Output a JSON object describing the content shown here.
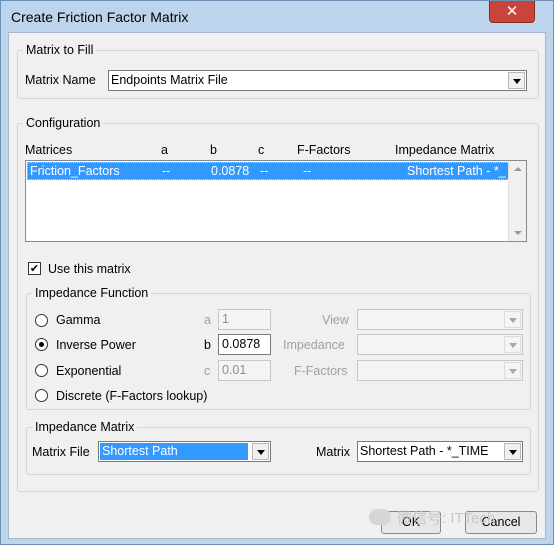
{
  "window": {
    "title": "Create Friction Factor Matrix",
    "close_glyph": "✕"
  },
  "matrix_to_fill": {
    "legend": "Matrix to Fill",
    "name_label": "Matrix Name",
    "name_value": "Endpoints Matrix File"
  },
  "configuration": {
    "legend": "Configuration",
    "columns": [
      "Matrices",
      "a",
      "b",
      "c",
      "F-Factors",
      "Impedance Matrix"
    ],
    "rows": [
      {
        "matrices": "Friction_Factors",
        "a": "--",
        "b": "0.0878",
        "c": "--",
        "f_factors": "--",
        "impedance_matrix": "Shortest Path - *_"
      }
    ],
    "use_matrix_label": "Use this matrix",
    "use_matrix_checked": true
  },
  "impedance_function": {
    "legend": "Impedance Function",
    "options": [
      "Gamma",
      "Inverse Power",
      "Exponential",
      "Discrete (F-Factors lookup)"
    ],
    "selected": "Inverse Power",
    "param_a_label": "a",
    "param_a_value": "1",
    "param_b_label": "b",
    "param_b_value": "0.0878",
    "param_c_label": "c",
    "param_c_value": "0.01",
    "view_label": "View",
    "impedance_label": "Impedance",
    "ffactors_label": "F-Factors"
  },
  "impedance_matrix": {
    "legend": "Impedance Matrix",
    "file_label": "Matrix File",
    "file_value": "Shortest Path",
    "matrix_label": "Matrix",
    "matrix_value": "Shortest Path - *_TIME"
  },
  "buttons": {
    "ok": "OK",
    "cancel": "Cancel"
  },
  "watermark": "微信号: ITTech",
  "colors": {
    "selection": "#3399ff",
    "title_bar": "#bcd4ec",
    "close_button": "#c9453a"
  }
}
